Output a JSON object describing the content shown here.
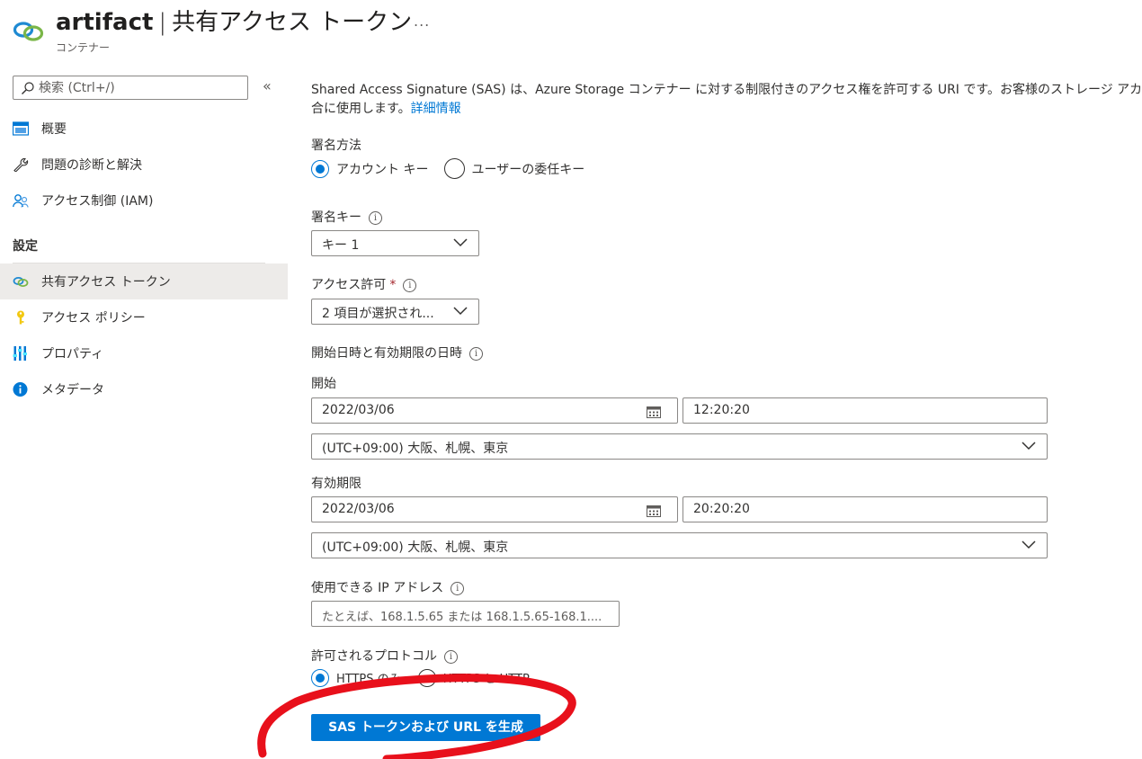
{
  "header": {
    "resource_name": "artifact",
    "separator": "|",
    "page_title": "共有アクセス トークン",
    "subtitle": "コンテナー",
    "more": "..."
  },
  "sidebar": {
    "search_placeholder": "検索 (Ctrl+/)",
    "collapse": "«",
    "items_top": [
      {
        "label": "概要",
        "icon": "overview-icon"
      },
      {
        "label": "問題の診断と解決",
        "icon": "wrench-icon"
      },
      {
        "label": "アクセス制御 (IAM)",
        "icon": "people-icon"
      }
    ],
    "section_title": "設定",
    "items_settings": [
      {
        "label": "共有アクセス トークン",
        "icon": "link-icon",
        "active": true
      },
      {
        "label": "アクセス ポリシー",
        "icon": "key-icon"
      },
      {
        "label": "プロパティ",
        "icon": "properties-icon"
      },
      {
        "label": "メタデータ",
        "icon": "info-icon"
      }
    ]
  },
  "main": {
    "description_line1": "Shared Access Signature (SAS) は、Azure Storage コンテナー に対する制限付きのアクセス権を許可する URI です。お客様のストレージ アカウン",
    "description_line2": "合に使用します。",
    "learn_more": "詳細情報",
    "signing_method": {
      "label": "署名方法",
      "options": [
        {
          "label": "アカウント キー",
          "selected": true
        },
        {
          "label": "ユーザーの委任キー",
          "selected": false
        }
      ]
    },
    "signing_key": {
      "label": "署名キー",
      "value": "キー 1"
    },
    "permissions": {
      "label": "アクセス許可",
      "required": "*",
      "value": "2 項目が選択され..."
    },
    "datetime_label": "開始日時と有効期限の日時",
    "start": {
      "label": "開始",
      "date": "2022/03/06",
      "time": "12:20:20",
      "timezone": "(UTC+09:00) 大阪、札幌、東京"
    },
    "expiry": {
      "label": "有効期限",
      "date": "2022/03/06",
      "time": "20:20:20",
      "timezone": "(UTC+09:00) 大阪、札幌、東京"
    },
    "allowed_ip": {
      "label": "使用できる IP アドレス",
      "placeholder": "たとえば、168.1.5.65 または 168.1.5.65-168.1...."
    },
    "protocols": {
      "label": "許可されるプロトコル",
      "options": [
        {
          "label": "HTTPS のみ",
          "selected": true
        },
        {
          "label": "HTTPS と HTTP",
          "selected": false
        }
      ]
    },
    "generate_button": "SAS トークンおよび URL を生成"
  },
  "colors": {
    "accent": "#0078d4",
    "annotation": "#e8101b",
    "active_nav": "#edebe9"
  }
}
